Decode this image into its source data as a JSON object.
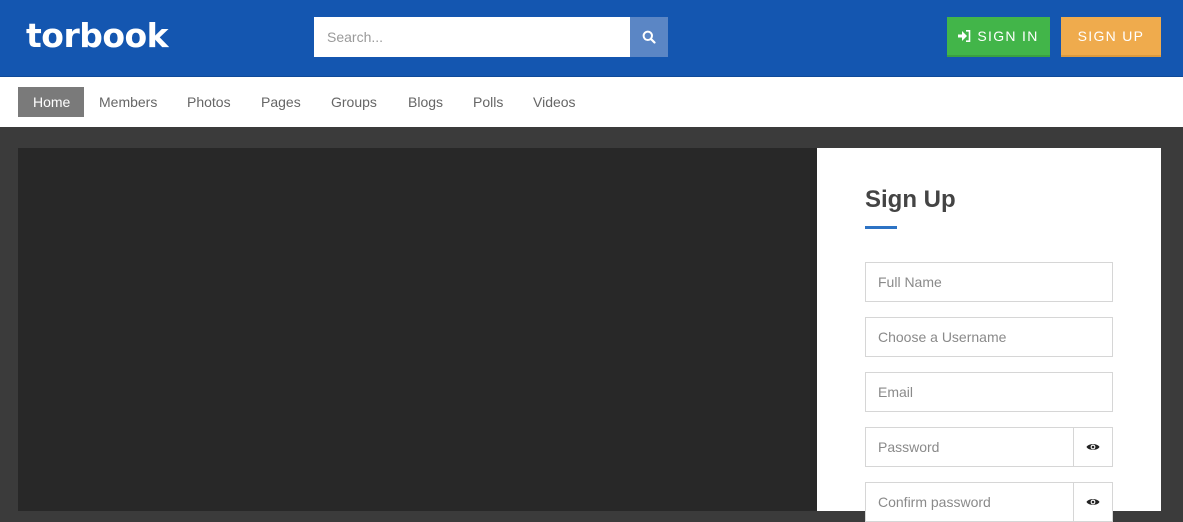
{
  "header": {
    "logo": "torbook",
    "search_placeholder": "Search...",
    "signin_label": "SIGN IN",
    "signup_label": "SIGN UP",
    "colors": {
      "bar": "#1456b0",
      "signin": "#42b549",
      "signup": "#efab4d"
    }
  },
  "nav": {
    "items": [
      {
        "label": "Home",
        "active": true
      },
      {
        "label": "Members"
      },
      {
        "label": "Photos"
      },
      {
        "label": "Pages"
      },
      {
        "label": "Groups"
      },
      {
        "label": "Blogs"
      },
      {
        "label": "Polls"
      },
      {
        "label": "Videos"
      }
    ]
  },
  "signup_form": {
    "title": "Sign Up",
    "fields": {
      "full_name": "Full Name",
      "username": "Choose a Username",
      "email": "Email",
      "password": "Password",
      "confirm_password": "Confirm password"
    },
    "icons": {
      "toggle_password": "eye-icon"
    },
    "accent": "#2d73c4"
  }
}
